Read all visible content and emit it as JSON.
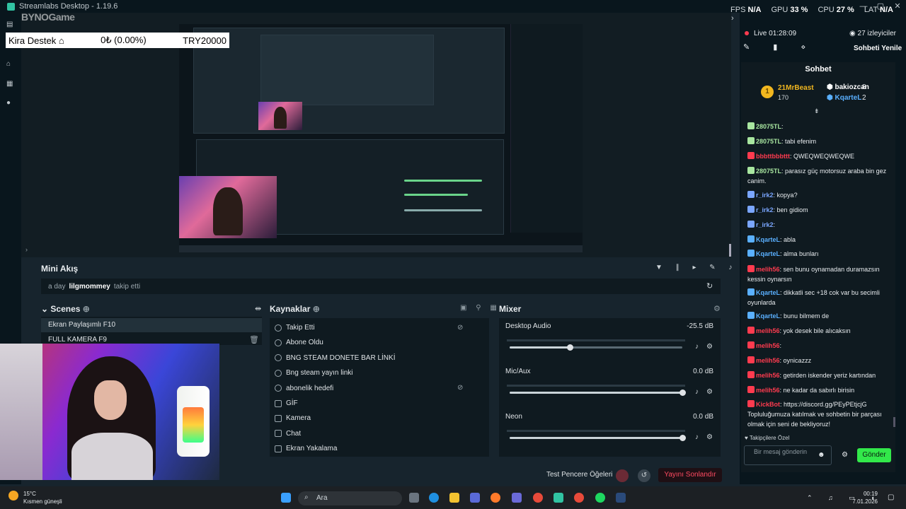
{
  "window": {
    "title": "Streamlabs Desktop - 1.19.6",
    "minimize": "—",
    "maximize": "▢",
    "close": "✕"
  },
  "stats": {
    "fps_label": "FPS",
    "fps_value": "N/A",
    "gpu_label": "GPU",
    "gpu_value": "33 %",
    "cpu_label": "CPU",
    "cpu_value": "27 %",
    "lat_label": "LAT",
    "lat_value": "N/A"
  },
  "overlay": {
    "logo": "BYNOGame",
    "name": "Kira Destek",
    "amount": "0₺ (0.00%)",
    "goal": "TRY20000"
  },
  "mini_feed": {
    "title": "Mini Akış",
    "time": "a day",
    "user": "lilgmommey",
    "action": "takip etti"
  },
  "scenes": {
    "title": "Scenes",
    "items": [
      "Ekran Paylaşımlı F10",
      "FULL KAMERA F9"
    ]
  },
  "sources": {
    "title": "Kaynaklar",
    "items": [
      "Takip Etti",
      "Abone Oldu",
      "BNG STEAM DONETE BAR LİNKİ",
      "Bng steam yayın linki",
      "abonelik hedefi",
      "GİF",
      "Kamera",
      "Chat",
      "Ekran Yakalama"
    ]
  },
  "mixer": {
    "title": "Mixer",
    "channels": [
      {
        "name": "Desktop Audio",
        "db": "-25.5 dB",
        "level": 0.35
      },
      {
        "name": "Mic/Aux",
        "db": "0.0 dB",
        "level": 1.0
      },
      {
        "name": "Neon",
        "db": "0.0 dB",
        "level": 1.0
      }
    ]
  },
  "bottom": {
    "test_label": "Test Pencere Öğeleri",
    "end_label": "Yayını Sonlandır"
  },
  "live": {
    "status": "Live",
    "time": "01:28:09",
    "viewers": "27 izleyiciler",
    "refresh": "Sohbeti Yenile"
  },
  "chat": {
    "header": "Sohbet",
    "top": {
      "first_name": "21MrBeast",
      "first_amount": "170",
      "second_name": "bakiozcan",
      "second_amount": "8",
      "third_name": "KqarteL",
      "third_amount": "2"
    },
    "messages": [
      {
        "user": "28075TL",
        "text": "",
        "color": "#a8e6a0"
      },
      {
        "user": "28075TL",
        "text": "tabi efenim",
        "color": "#a8e6a0"
      },
      {
        "user": "bbbttbbbttt",
        "text": "QWEQWEQWEQWE",
        "color": "#ff3b4f"
      },
      {
        "user": "28075TL",
        "text": "parasız güç motorsuz araba bin gez canim.",
        "color": "#a8e6a0"
      },
      {
        "user": "r_irk2",
        "text": "kopya?",
        "color": "#7aa6ff"
      },
      {
        "user": "r_irk2",
        "text": "ben gidiom",
        "color": "#7aa6ff"
      },
      {
        "user": "r_irk2",
        "text": "",
        "color": "#7aa6ff"
      },
      {
        "user": "KqarteL",
        "text": "abla",
        "color": "#5ab0ff"
      },
      {
        "user": "KqarteL",
        "text": "alma bunları",
        "color": "#5ab0ff"
      },
      {
        "user": "melih56",
        "text": "sen bunu oynamadan duramazsın kessin oynarsın",
        "color": "#ff3b4f"
      },
      {
        "user": "KqarteL",
        "text": "dikkatli sec +18 cok var bu secimli oyunlarda",
        "color": "#5ab0ff"
      },
      {
        "user": "KqarteL",
        "text": "bunu bilmem de",
        "color": "#5ab0ff"
      },
      {
        "user": "melih56",
        "text": "yok desek bile alıcaksın",
        "color": "#ff3b4f"
      },
      {
        "user": "melih56",
        "text": "",
        "color": "#ff3b4f"
      },
      {
        "user": "melih56",
        "text": "oynicazzz",
        "color": "#ff3b4f"
      },
      {
        "user": "melih56",
        "text": "getirden iskender yeriz kartından",
        "color": "#ff3b4f"
      },
      {
        "user": "melih56",
        "text": "ne kadar da sabırlı birisin",
        "color": "#ff3b4f"
      },
      {
        "user": "KickBot",
        "text": "https://discord.gg/PEyPEtjcjG Topluluğumuza katılmak ve sohbetin bir parçası olmak için seni de bekliyoruz!",
        "color": "#ff3b4f"
      }
    ],
    "follower_only": "Takipçilere Özel",
    "input_placeholder": "Bir mesaj gönderin",
    "send": "Gönder"
  },
  "taskbar": {
    "temp": "15°C",
    "weather": "Kısmen güneşli",
    "search": "Ara",
    "time": "00:19",
    "date": "7.01.2026"
  },
  "colors": {
    "accent": "#32e84a",
    "end_red": "#ff4a61",
    "live_red": "#ff3b4f"
  }
}
